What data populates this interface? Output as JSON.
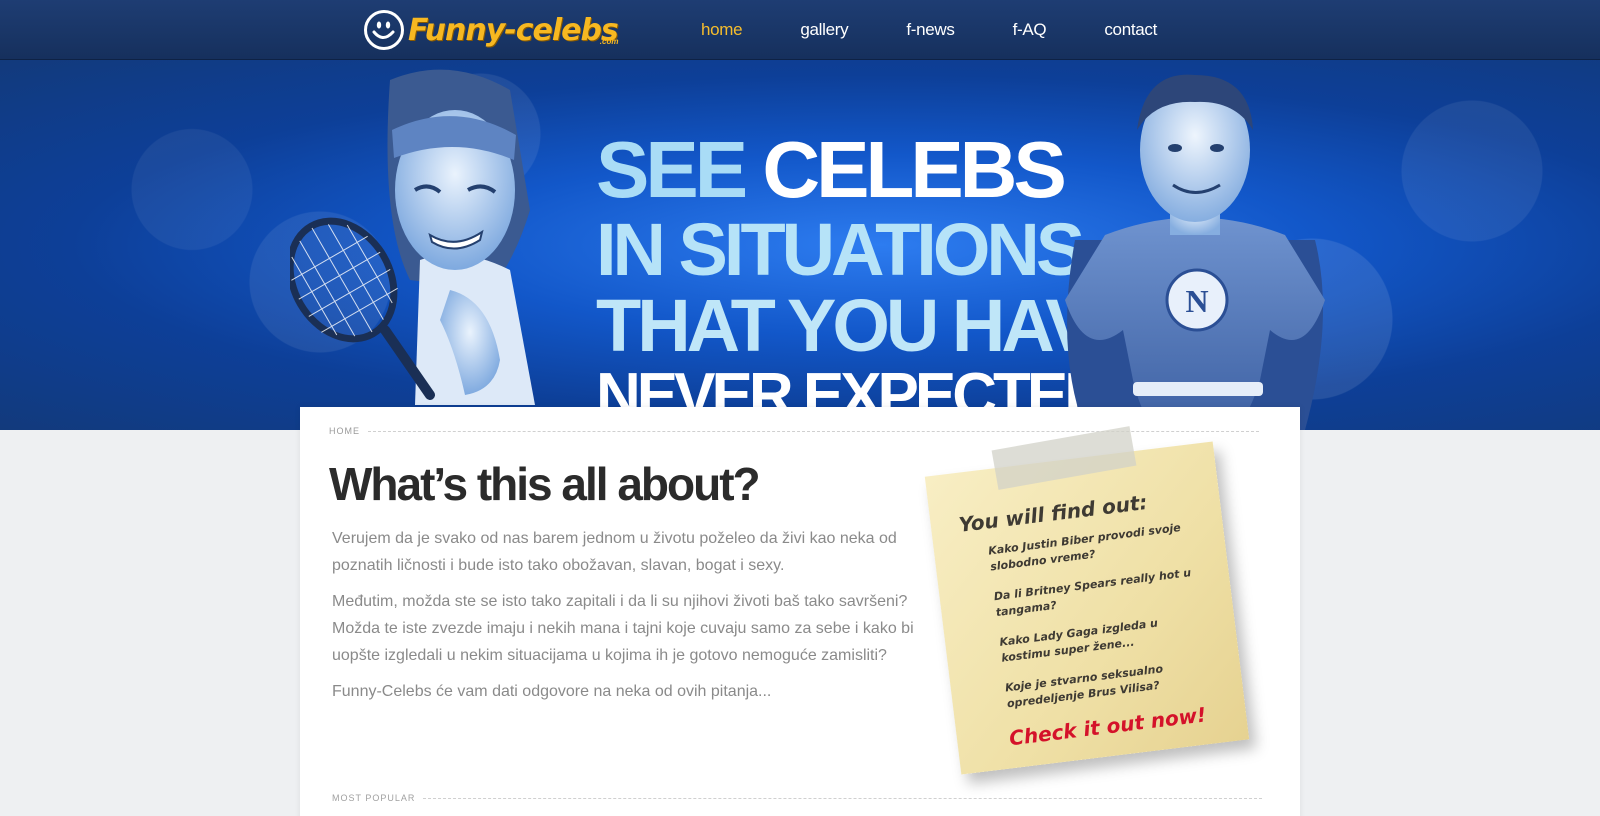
{
  "header": {
    "logo_text": "Funny-celebs",
    "logo_suffix": ".com",
    "nav": [
      {
        "label": "home",
        "active": true
      },
      {
        "label": "gallery",
        "active": false
      },
      {
        "label": "f-news",
        "active": false
      },
      {
        "label": "f-AQ",
        "active": false
      },
      {
        "label": "contact",
        "active": false
      }
    ]
  },
  "hero": {
    "line1_a": "SEE ",
    "line1_b": "CELEBS",
    "line2": "IN SITUATIONS",
    "line3": "THAT YOU HAVE",
    "line4": "NEVER EXPECTED"
  },
  "main": {
    "breadcrumb": "HOME",
    "title": "What’s this all about?",
    "paragraphs": [
      "Verujem da je svako od nas barem jednom u životu poželeo da živi kao neka od poznatih ličnosti i bude isto tako obožavan, slavan, bogat i sexy.",
      "Međutim, možda ste se isto tako zapitali i da li su njihovi životi baš tako savršeni? Možda te iste zvezde imaju i nekih mana i tajni koje cuvaju samo za sebe i kako bi uopšte izgledali u nekim situacijama u kojima ih je gotovo nemoguće zamisliti?",
      "Funny-Celebs će vam dati odgovore na neka od ovih pitanja..."
    ],
    "most_popular_label": "MOST POPULAR"
  },
  "note": {
    "title": "You will find out:",
    "items": [
      "Kako Justin Biber provodi svoje slobodno vreme?",
      "Da li Britney Spears really hot u tangama?",
      "Kako Lady Gaga izgleda u kostimu super žene...",
      "Koje je stvarno seksualno opredeljenje Brus Vilisa?"
    ],
    "cta": "Check it out now!"
  },
  "colors": {
    "topbar": "#1e3d73",
    "nav_active": "#f6bd2c",
    "logo": "#f7b821",
    "cta": "#d4122a"
  }
}
